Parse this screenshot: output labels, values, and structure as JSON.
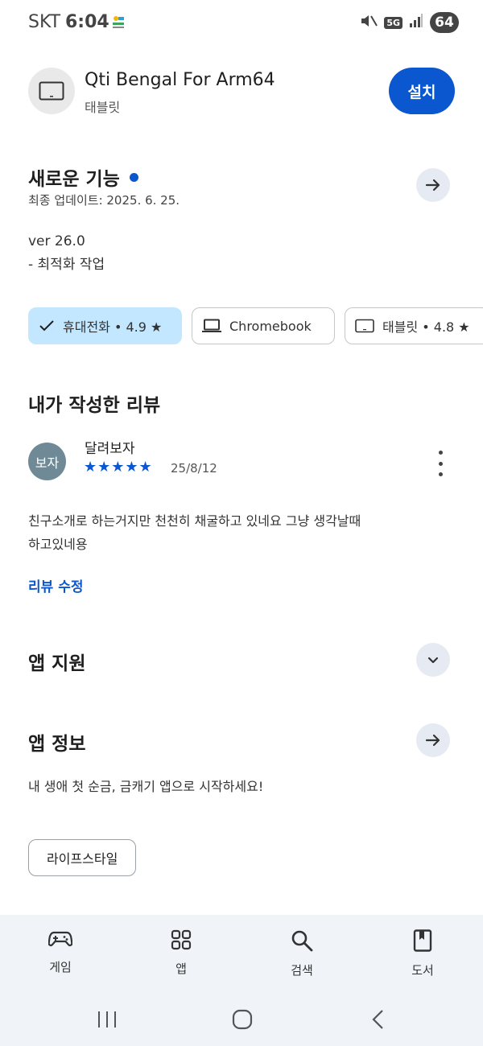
{
  "status_bar": {
    "carrier": "SKT",
    "time": "6:04",
    "network": "5G",
    "battery": "64"
  },
  "app": {
    "title": "Qti Bengal For Arm64",
    "subtitle": "태블릿",
    "install_label": "설치"
  },
  "whats_new": {
    "title": "새로운 기능",
    "updated": "최종 업데이트: 2025. 6. 25.",
    "version_line": "ver 26.0",
    "note_line": "- 최적화 작업"
  },
  "devices": [
    {
      "label": "휴대전화 • 4.9 ★",
      "active": true,
      "icon": "check-icon"
    },
    {
      "label": "Chromebook",
      "active": false,
      "icon": "laptop-icon"
    },
    {
      "label": "태블릿 • 4.8 ★",
      "active": false,
      "icon": "tablet-icon"
    }
  ],
  "my_review": {
    "title": "내가 작성한 리뷰",
    "avatar_text": "보자",
    "reviewer": "달려보자",
    "stars": "★★★★★",
    "rating": 5,
    "date": "25/8/12",
    "text_line1": "친구소개로 하는거지만 천천히 채굴하고 있네요 그냥 생각날때",
    "text_line2": "하고있네용",
    "edit_label": "리뷰 수정"
  },
  "app_support": {
    "title": "앱 지원"
  },
  "app_info": {
    "title": "앱 정보",
    "description": "내 생애 첫 순금, 금캐기 앱으로 시작하세요!",
    "category": "라이프스타일"
  },
  "bottom_nav": [
    {
      "label": "게임",
      "icon": "gamepad-icon"
    },
    {
      "label": "앱",
      "icon": "apps-grid-icon"
    },
    {
      "label": "검색",
      "icon": "search-icon"
    },
    {
      "label": "도서",
      "icon": "book-icon"
    }
  ],
  "colors": {
    "accent": "#0b57d0",
    "chip_active": "#c2e7ff",
    "nav_bg": "#f0f4f9"
  }
}
